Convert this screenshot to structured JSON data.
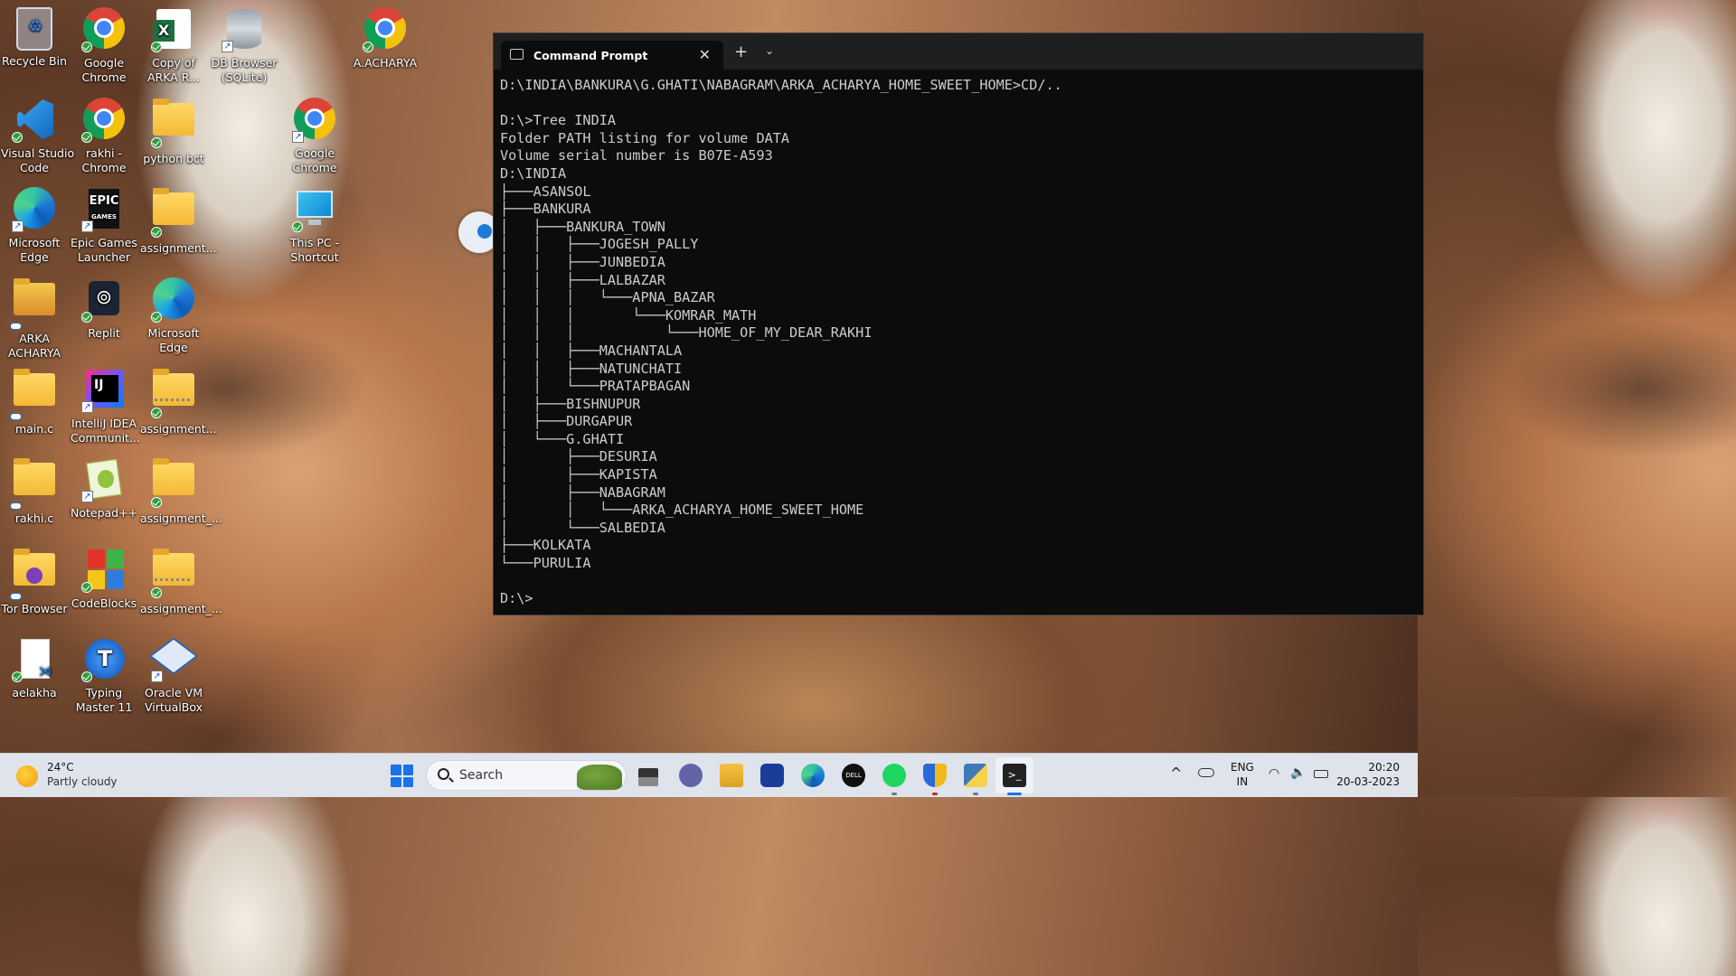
{
  "desktop": {
    "icons": [
      {
        "label": "Recycle Bin",
        "icon": "recycle-bin-icon"
      },
      {
        "label": "Google\nChrome",
        "icon": "chrome-icon"
      },
      {
        "label": "Copy of\nARKA R...",
        "icon": "excel-icon"
      },
      {
        "label": "DB Browser\n(SQLite)",
        "icon": "database-icon"
      },
      {
        "label": "A.ACHARYA",
        "icon": "chrome-icon"
      },
      {
        "label": "Visual Studio\nCode",
        "icon": "vscode-icon"
      },
      {
        "label": "rakhi -\nChrome",
        "icon": "chrome-icon"
      },
      {
        "label": "python bct",
        "icon": "folder-icon"
      },
      {
        "label": "Google\nChrome",
        "icon": "chrome-icon"
      },
      {
        "label": "Microsoft\nEdge",
        "icon": "edge-icon"
      },
      {
        "label": "Epic Games\nLauncher",
        "icon": "epic-games-icon"
      },
      {
        "label": "assignment...",
        "icon": "folder-icon"
      },
      {
        "label": "This PC -\nShortcut",
        "icon": "monitor-icon"
      },
      {
        "label": "ARKA\nACHARYA",
        "icon": "folder-icon"
      },
      {
        "label": "Replit",
        "icon": "replit-icon"
      },
      {
        "label": "Microsoft\nEdge",
        "icon": "edge-icon"
      },
      {
        "label": "main.c",
        "icon": "folder-icon"
      },
      {
        "label": "IntelliJ IDEA\nCommunit...",
        "icon": "intellij-icon"
      },
      {
        "label": "assignment...",
        "icon": "zip-folder-icon"
      },
      {
        "label": "rakhi.c",
        "icon": "folder-icon"
      },
      {
        "label": "Notepad++",
        "icon": "notepad-plus-plus-icon"
      },
      {
        "label": "assignment_...",
        "icon": "folder-icon"
      },
      {
        "label": "Tor Browser",
        "icon": "tor-folder-icon"
      },
      {
        "label": "CodeBlocks",
        "icon": "codeblocks-icon"
      },
      {
        "label": "assignment_...",
        "icon": "zip-folder-icon"
      },
      {
        "label": "aelakha",
        "icon": "vscode-file-icon"
      },
      {
        "label": "Typing\nMaster 11",
        "icon": "typing-master-icon"
      },
      {
        "label": "Oracle VM\nVirtualBox",
        "icon": "virtualbox-icon"
      }
    ]
  },
  "terminal": {
    "tab_title": "Command Prompt",
    "close_glyph": "✕",
    "new_tab_glyph": "+",
    "dropdown_glyph": "⌄",
    "lines": [
      "D:\\INDIA\\BANKURA\\G.GHATI\\NABAGRAM\\ARKA_ACHARYA_HOME_SWEET_HOME>CD/..",
      "",
      "D:\\>Tree INDIA",
      "Folder PATH listing for volume DATA",
      "Volume serial number is B07E-A593",
      "D:\\INDIA",
      "├───ASANSOL",
      "├───BANKURA",
      "│   ├───BANKURA_TOWN",
      "│   │   ├───JOGESH_PALLY",
      "│   │   ├───JUNBEDIA",
      "│   │   ├───LALBAZAR",
      "│   │   │   └───APNA_BAZAR",
      "│   │   │       └───KOMRAR_MATH",
      "│   │   │           └───HOME_OF_MY_DEAR_RAKHI",
      "│   │   ├───MACHANTALA",
      "│   │   ├───NATUNCHATI",
      "│   │   └───PRATAPBAGAN",
      "│   ├───BISHNUPUR",
      "│   ├───DURGAPUR",
      "│   └───G.GHATI",
      "│       ├───DESURIA",
      "│       ├───KAPISTA",
      "│       ├───NABAGRAM",
      "│       │   └───ARKA_ACHARYA_HOME_SWEET_HOME",
      "│       └───SALBEDIA",
      "├───KOLKATA",
      "└───PURULIA",
      "",
      "D:\\>"
    ]
  },
  "taskbar": {
    "weather_temp": "24°C",
    "weather_desc": "Partly cloudy",
    "search_placeholder": "Search",
    "apps": [
      "start-icon",
      "task-view-icon",
      "teams-chat-icon",
      "file-explorer-icon",
      "microsoft-store-icon",
      "edge-icon",
      "dell-icon",
      "spotify-icon",
      "security-shield-icon",
      "python-icon",
      "terminal-icon"
    ],
    "lang_1": "ENG",
    "lang_2": "IN",
    "time": "20:20",
    "date": "20-03-2023",
    "chevron": "^",
    "colors": {
      "taskbar": "#dfe3ec",
      "accent": "#1a73e8",
      "terminal_bg": "#0c0c0c"
    }
  }
}
